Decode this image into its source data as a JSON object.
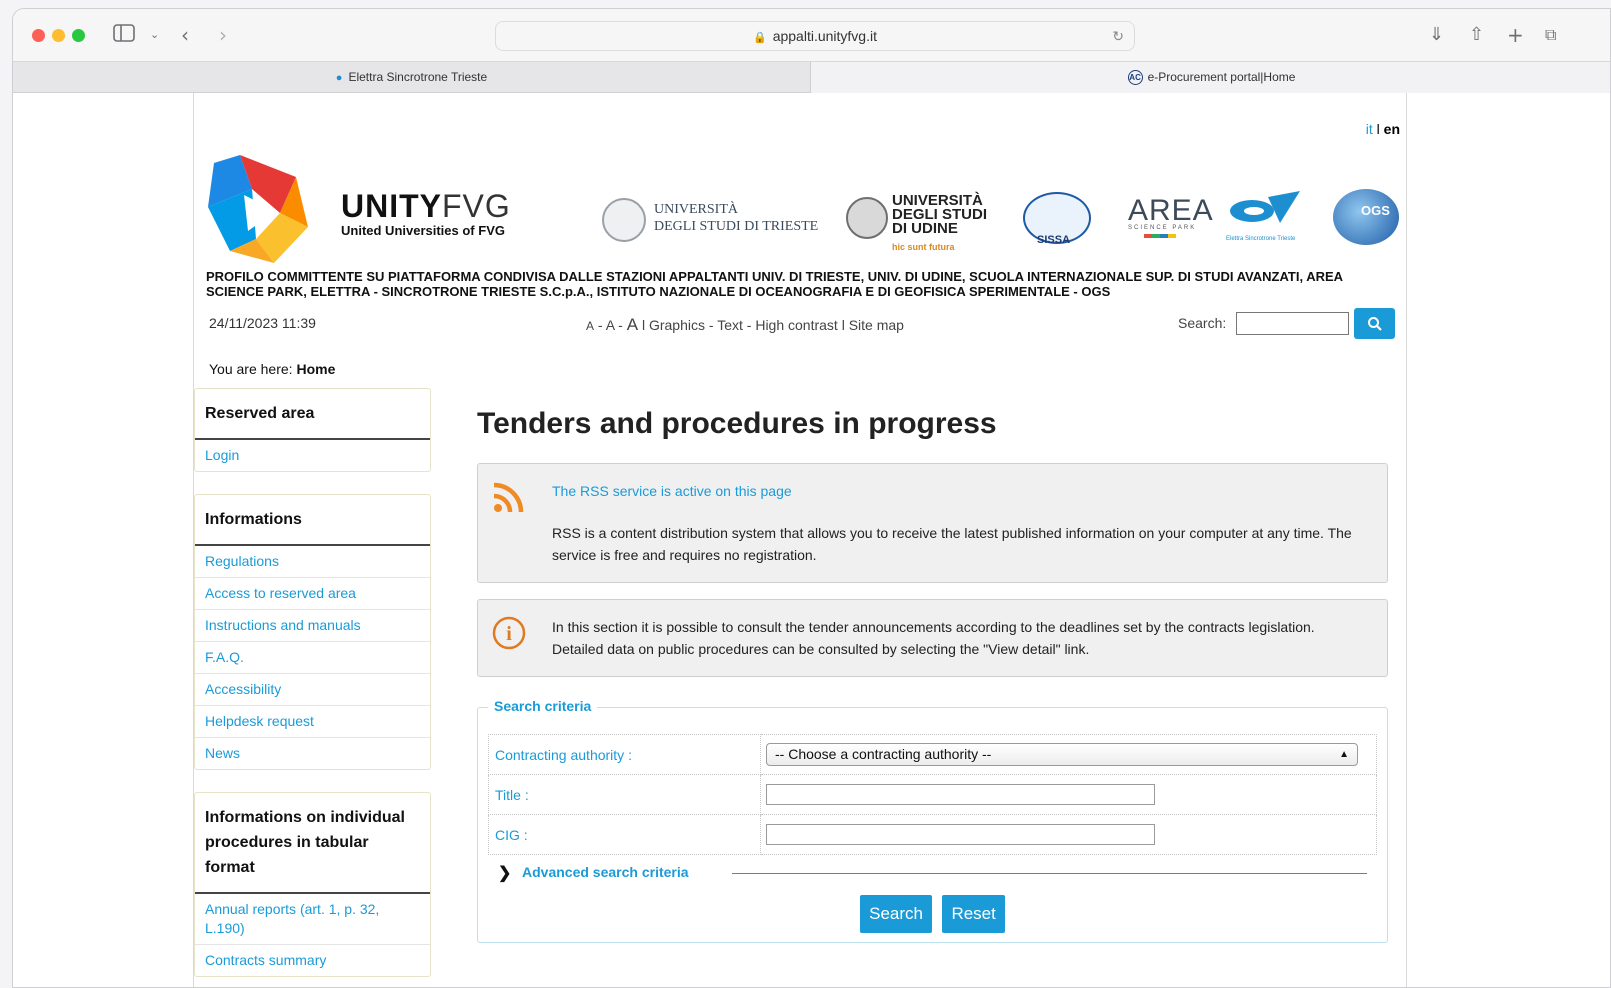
{
  "browser": {
    "url": "appalti.unityfvg.it",
    "tabs": [
      {
        "label": "Elettra Sincrotrone Trieste"
      },
      {
        "label": "e-Procurement portal|Home"
      }
    ]
  },
  "header": {
    "lang_it": "it",
    "lang_sep": "l",
    "lang_en": "en",
    "brand_bold": "UNITY",
    "brand_light": "FVG",
    "brand_sub": "United Universities of FVG",
    "partners": {
      "trieste_line1": "UNIVERSITÀ",
      "trieste_line2": "DEGLI STUDI DI TRIESTE",
      "udine_line1": "UNIVERSITÀ",
      "udine_line2": "DEGLI STUDI",
      "udine_line3": "DI UDINE",
      "udine_motto": "hic sunt futura",
      "sissa": "SISSA",
      "area": "AREA",
      "area_sub": "SCIENCE PARK",
      "elettra": "Elettra Sincrotrone Trieste",
      "ogs": "OGS"
    },
    "profile_text": "PROFILO COMMITTENTE SU PIATTAFORMA CONDIVISA DALLE STAZIONI APPALTANTI UNIV. DI TRIESTE, UNIV. DI UDINE, SCUOLA INTERNAZIONALE SUP. DI STUDI AVANZATI, AREA SCIENCE PARK, ELETTRA - SINCROTRONE TRIESTE S.C.p.A., ISTITUTO NAZIONALE DI OCEANOGRAFIA E DI GEOFISICA SPERIMENTALE - OGS"
  },
  "utility": {
    "date": "24/11/2023 11:39",
    "font_small": "A",
    "font_medium": "A",
    "font_large": "A",
    "graphics": "Graphics",
    "text": "Text",
    "high_contrast": "High contrast",
    "site_map": "Site map",
    "search_label": "Search:"
  },
  "breadcrumb": {
    "prefix": "You are here:",
    "current": "Home"
  },
  "sidebar": {
    "reserved": {
      "title": "Reserved area",
      "items": [
        {
          "label": "Login"
        }
      ]
    },
    "informations": {
      "title": "Informations",
      "items": [
        {
          "label": "Regulations"
        },
        {
          "label": "Access to reserved area"
        },
        {
          "label": "Instructions and manuals"
        },
        {
          "label": "F.A.Q."
        },
        {
          "label": "Accessibility"
        },
        {
          "label": "Helpdesk request"
        },
        {
          "label": "News"
        }
      ]
    },
    "tabular": {
      "title": "Informations on individual procedures in tabular format",
      "items": [
        {
          "label": "Annual reports (art. 1, p. 32, L.190)"
        },
        {
          "label": "Contracts summary"
        }
      ]
    }
  },
  "main": {
    "title": "Tenders and procedures in progress",
    "rss_link": "The RSS service is active on this page",
    "rss_text": "RSS is a content distribution system that allows you to receive the latest published information on your computer at any time. The service is free and requires no registration.",
    "info_line1": "In this section it is possible to consult the tender announcements according to the deadlines set by the contracts legislation.",
    "info_line2": "Detailed data on public procedures can be consulted by selecting the \"View detail\" link.",
    "search_criteria": {
      "legend": "Search criteria",
      "authority_label": "Contracting authority :",
      "authority_value": "-- Choose a contracting authority --",
      "title_label": "Title :",
      "title_value": "",
      "cig_label": "CIG :",
      "cig_value": "",
      "advanced": "Advanced search criteria",
      "search_button": "Search",
      "reset_button": "Reset"
    }
  },
  "colors": {
    "accent": "#1a9bd7",
    "rss": "#f08a24",
    "info": "#e07a22"
  }
}
